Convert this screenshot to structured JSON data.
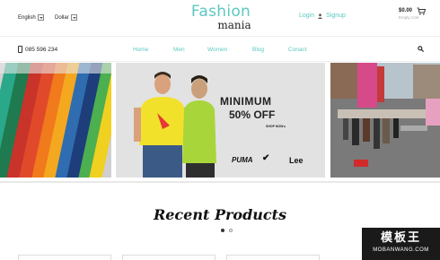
{
  "topbar": {
    "language": "English",
    "currency": "Dollar",
    "logo_line1": "Fashion",
    "logo_line2": "mania",
    "login": "Login",
    "separator_icon": "user-icon",
    "signup": "Signup",
    "cart_price": "$0.00",
    "cart_status": "Empty Cart"
  },
  "navbar": {
    "phone": "085 596 234",
    "items": [
      "Home",
      "Men",
      "Women",
      "Blog",
      "Conact"
    ]
  },
  "slider": {
    "promo_line1": "MINIMUM",
    "promo_line2": "50% OFF",
    "shop_now": "SHOP NOW ▸",
    "brands": [
      "PUMA",
      "✔",
      "Lee"
    ],
    "active_dot": 0,
    "dot_count": 2
  },
  "section": {
    "title": "Recent Products"
  },
  "watermark": {
    "line1": "模板王",
    "line2": "MOBANWANG.COM"
  },
  "colors": {
    "accent": "#5cc8c0"
  }
}
